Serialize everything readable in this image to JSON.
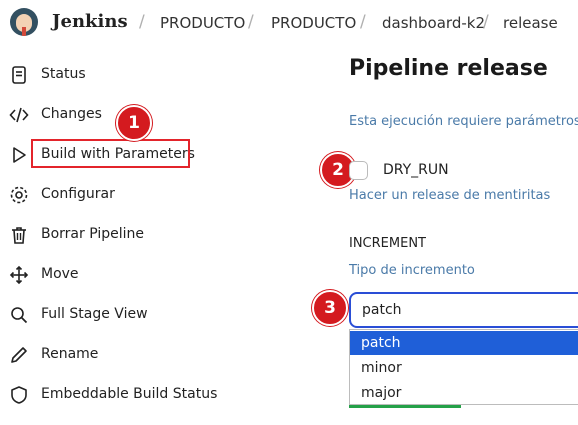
{
  "header": {
    "brand": "Jenkins",
    "breadcrumbs": [
      "PRODUCTO",
      "PRODUCTO",
      "dashboard-k2",
      "release"
    ]
  },
  "sidebar": {
    "items": [
      {
        "label": "Status",
        "icon": "document-icon"
      },
      {
        "label": "Changes",
        "icon": "code-icon"
      },
      {
        "label": "Build with Parameters",
        "icon": "play-icon"
      },
      {
        "label": "Configurar",
        "icon": "gear-icon"
      },
      {
        "label": "Borrar Pipeline",
        "icon": "trash-icon"
      },
      {
        "label": "Move",
        "icon": "move-icon"
      },
      {
        "label": "Full Stage View",
        "icon": "search-icon"
      },
      {
        "label": "Rename",
        "icon": "pencil-icon"
      },
      {
        "label": "Embeddable Build Status",
        "icon": "shield-icon"
      }
    ]
  },
  "annotations": [
    "1",
    "2",
    "3"
  ],
  "main": {
    "title": "Pipeline release",
    "notice": "Esta ejecución requiere parámetros a",
    "dry_run": {
      "label": "DRY_RUN",
      "help": "Hacer un release de mentiritas",
      "checked": false
    },
    "increment": {
      "name": "INCREMENT",
      "help": "Tipo de incremento",
      "value": "patch",
      "options": [
        "patch",
        "minor",
        "major"
      ],
      "highlighted": "patch"
    }
  },
  "colors": {
    "accent": "#2a4ed6",
    "highlight": "#1f5fd8",
    "annotation": "#d41a1f",
    "link": "#4a7aa8",
    "success": "#24a148"
  }
}
